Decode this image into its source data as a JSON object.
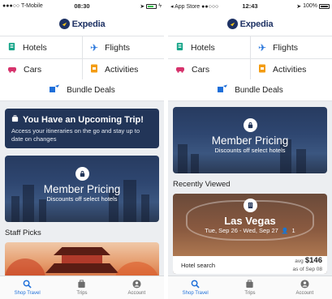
{
  "left": {
    "status": {
      "carrier": "●●●○○ T-Mobile",
      "time": "08:30"
    },
    "brand": "Expedia",
    "grid": {
      "hotels": "Hotels",
      "flights": "Flights",
      "cars": "Cars",
      "activities": "Activities"
    },
    "bundle": "Bundle Deals",
    "trip": {
      "title": "You Have an Upcoming Trip!",
      "subtitle": "Access your itineraries on the go and stay up to date on changes"
    },
    "member": {
      "title": "Member Pricing",
      "subtitle": "Discounts off select hotels"
    },
    "staff_picks": "Staff Picks",
    "tabs": {
      "shop": "Shop Travel",
      "trips": "Trips",
      "account": "Account"
    }
  },
  "right": {
    "status": {
      "carrier": "◂ App Store ●●○○○",
      "time": "12:43",
      "battery": "100%"
    },
    "brand": "Expedia",
    "grid": {
      "hotels": "Hotels",
      "flights": "Flights",
      "cars": "Cars",
      "activities": "Activities"
    },
    "bundle": "Bundle Deals",
    "member": {
      "title": "Member Pricing",
      "subtitle": "Discounts off select hotels"
    },
    "recently_viewed": "Recently Viewed",
    "recent": {
      "city": "Las Vegas",
      "dates": "Tue, Sep 26 - Wed, Sep 27",
      "guests": "1",
      "hotel_search": "Hotel search",
      "avg": "avg",
      "price": "$146",
      "as_of": "as of Sep 08"
    },
    "tabs": {
      "shop": "Shop Travel",
      "trips": "Trips",
      "account": "Account"
    }
  },
  "colors": {
    "brand_navy": "#1e3264",
    "card_navy": "#223558",
    "accent_blue": "#1e6fd9",
    "hotel_green": "#17a589",
    "car_pink": "#d6336c",
    "activities_orange": "#f39c12",
    "flight_blue": "#1e6fd9"
  },
  "icons": [
    "expedia-globe-icon",
    "hotel-icon",
    "plane-icon",
    "car-icon",
    "ticket-icon",
    "bundle-icon",
    "suitcase-icon",
    "lock-tag-icon",
    "hotel-building-icon",
    "search-icon",
    "account-icon"
  ]
}
